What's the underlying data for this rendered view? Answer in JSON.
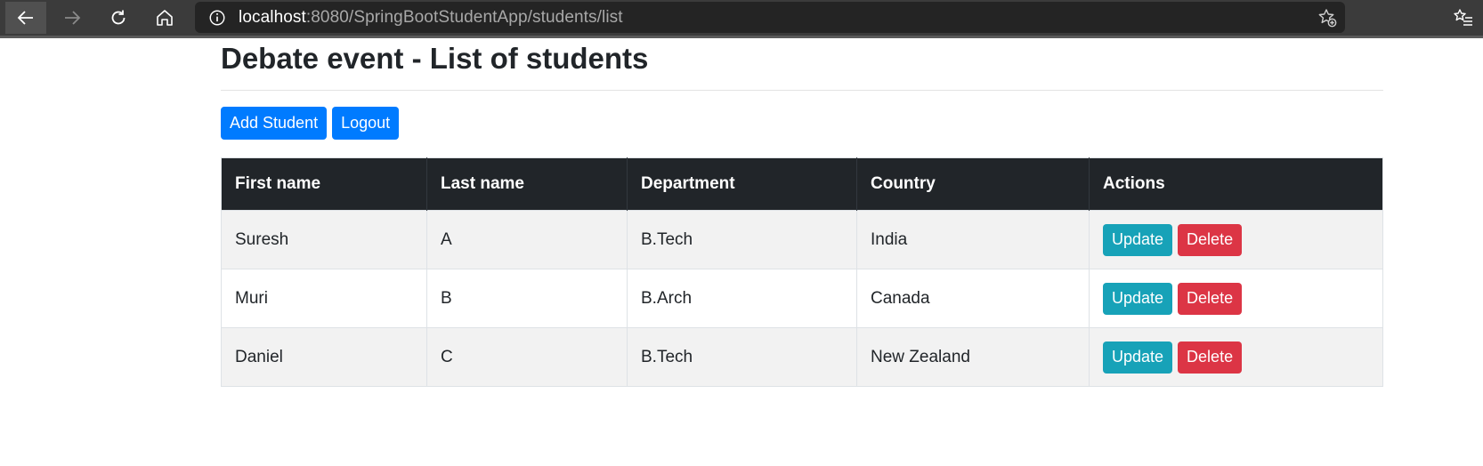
{
  "browser": {
    "url_host": "localhost",
    "url_path": ":8080/SpringBootStudentApp/students/list"
  },
  "page": {
    "title": "Debate event - List of students",
    "add_button": "Add Student",
    "logout_button": "Logout"
  },
  "table": {
    "headers": {
      "first_name": "First name",
      "last_name": "Last name",
      "department": "Department",
      "country": "Country",
      "actions": "Actions"
    },
    "rows": [
      {
        "first_name": "Suresh",
        "last_name": "A",
        "department": "B.Tech",
        "country": "India",
        "update": "Update",
        "delete": "Delete"
      },
      {
        "first_name": "Muri",
        "last_name": "B",
        "department": "B.Arch",
        "country": "Canada",
        "update": "Update",
        "delete": "Delete"
      },
      {
        "first_name": "Daniel",
        "last_name": "C",
        "department": "B.Tech",
        "country": "New Zealand",
        "update": "Update",
        "delete": "Delete"
      }
    ]
  },
  "colors": {
    "primary": "#007bff",
    "info": "#17a2b8",
    "danger": "#dc3545",
    "table_header": "#212529"
  },
  "icons": [
    "back-arrow-icon",
    "forward-arrow-icon",
    "reload-icon",
    "home-icon",
    "info-icon",
    "add-favorite-icon",
    "favorites-icon"
  ]
}
